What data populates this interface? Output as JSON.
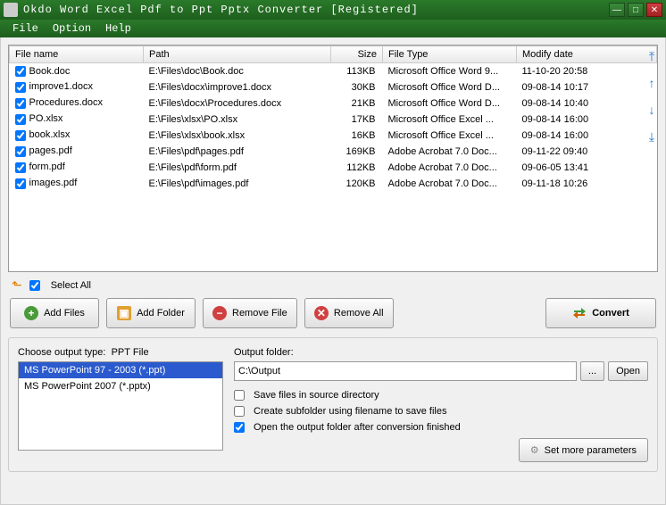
{
  "title": "Okdo Word Excel Pdf to Ppt Pptx Converter [Registered]",
  "menu": {
    "file": "File",
    "option": "Option",
    "help": "Help"
  },
  "columns": {
    "name": "File name",
    "path": "Path",
    "size": "Size",
    "type": "File Type",
    "date": "Modify date"
  },
  "files": [
    {
      "checked": true,
      "name": "Book.doc",
      "path": "E:\\Files\\doc\\Book.doc",
      "size": "113KB",
      "type": "Microsoft Office Word 9...",
      "date": "11-10-20 20:58"
    },
    {
      "checked": true,
      "name": "improve1.docx",
      "path": "E:\\Files\\docx\\improve1.docx",
      "size": "30KB",
      "type": "Microsoft Office Word D...",
      "date": "09-08-14 10:17"
    },
    {
      "checked": true,
      "name": "Procedures.docx",
      "path": "E:\\Files\\docx\\Procedures.docx",
      "size": "21KB",
      "type": "Microsoft Office Word D...",
      "date": "09-08-14 10:40"
    },
    {
      "checked": true,
      "name": "PO.xlsx",
      "path": "E:\\Files\\xlsx\\PO.xlsx",
      "size": "17KB",
      "type": "Microsoft Office Excel ...",
      "date": "09-08-14 16:00"
    },
    {
      "checked": true,
      "name": "book.xlsx",
      "path": "E:\\Files\\xlsx\\book.xlsx",
      "size": "16KB",
      "type": "Microsoft Office Excel ...",
      "date": "09-08-14 16:00"
    },
    {
      "checked": true,
      "name": "pages.pdf",
      "path": "E:\\Files\\pdf\\pages.pdf",
      "size": "169KB",
      "type": "Adobe Acrobat 7.0 Doc...",
      "date": "09-11-22 09:40"
    },
    {
      "checked": true,
      "name": "form.pdf",
      "path": "E:\\Files\\pdf\\form.pdf",
      "size": "112KB",
      "type": "Adobe Acrobat 7.0 Doc...",
      "date": "09-06-05 13:41"
    },
    {
      "checked": true,
      "name": "images.pdf",
      "path": "E:\\Files\\pdf\\images.pdf",
      "size": "120KB",
      "type": "Adobe Acrobat 7.0 Doc...",
      "date": "09-11-18 10:26"
    }
  ],
  "selectall": {
    "label": "Select All",
    "checked": true
  },
  "buttons": {
    "addfiles": "Add Files",
    "addfolder": "Add Folder",
    "removefile": "Remove File",
    "removeall": "Remove All",
    "convert": "Convert"
  },
  "outputtype": {
    "label": "Choose output type:",
    "current": "PPT File",
    "items": [
      {
        "label": "MS PowerPoint 97 - 2003 (*.ppt)",
        "selected": true
      },
      {
        "label": "MS PowerPoint 2007 (*.pptx)",
        "selected": false
      }
    ]
  },
  "outputfolder": {
    "label": "Output folder:",
    "value": "C:\\Output",
    "browse": "...",
    "open": "Open"
  },
  "options": {
    "savesource": {
      "label": "Save files in source directory",
      "checked": false
    },
    "subfolder": {
      "label": "Create subfolder using filename to save files",
      "checked": false
    },
    "openfolder": {
      "label": "Open the output folder after conversion finished",
      "checked": true
    }
  },
  "moreparams": "Set more parameters"
}
